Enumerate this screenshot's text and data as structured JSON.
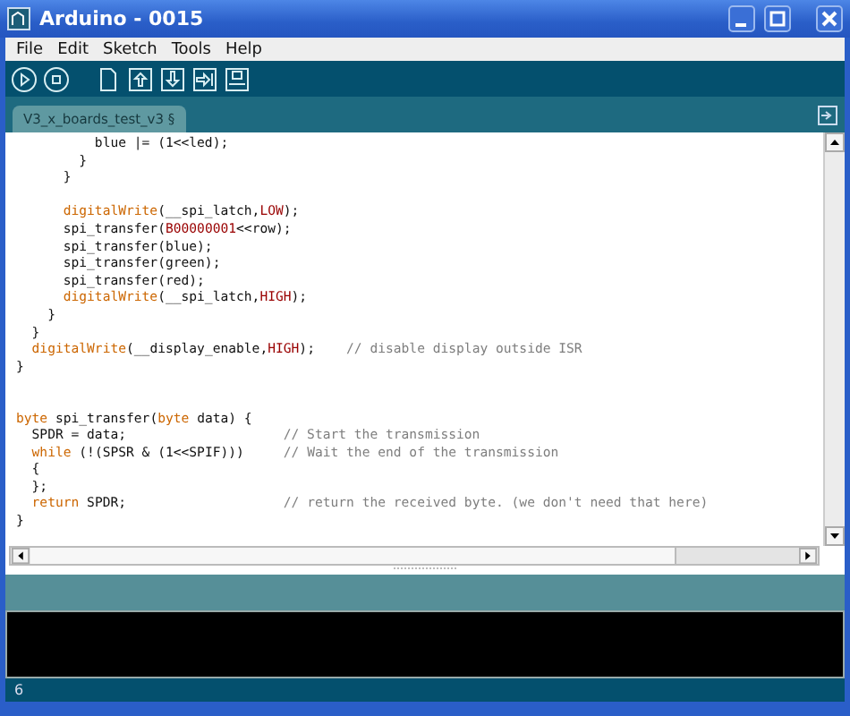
{
  "window": {
    "title": "Arduino - 0015"
  },
  "menu": [
    {
      "label": "File"
    },
    {
      "label": "Edit"
    },
    {
      "label": "Sketch"
    },
    {
      "label": "Tools"
    },
    {
      "label": "Help"
    }
  ],
  "tabs": [
    {
      "label": "V3_x_boards_test_v3 §",
      "selected": true
    }
  ],
  "editor": {
    "lines": [
      {
        "kind": "code",
        "tokens": [
          {
            "kind": "plain",
            "text": "          blue |= (1<<led);"
          }
        ]
      },
      {
        "kind": "code",
        "tokens": [
          {
            "kind": "plain",
            "text": "        }"
          }
        ]
      },
      {
        "kind": "code",
        "tokens": [
          {
            "kind": "plain",
            "text": "      }"
          }
        ]
      },
      {
        "kind": "blank"
      },
      {
        "kind": "code",
        "tokens": [
          {
            "kind": "keyword",
            "text": "      digitalWrite"
          },
          {
            "kind": "plain",
            "text": "(__spi_latch,"
          },
          {
            "kind": "constant",
            "text": "LOW"
          },
          {
            "kind": "plain",
            "text": ");"
          }
        ]
      },
      {
        "kind": "code",
        "tokens": [
          {
            "kind": "plain",
            "text": "      spi_transfer("
          },
          {
            "kind": "constant",
            "text": "B00000001"
          },
          {
            "kind": "plain",
            "text": "<<row);"
          }
        ]
      },
      {
        "kind": "code",
        "tokens": [
          {
            "kind": "plain",
            "text": "      spi_transfer(blue);"
          }
        ]
      },
      {
        "kind": "code",
        "tokens": [
          {
            "kind": "plain",
            "text": "      spi_transfer(green);"
          }
        ]
      },
      {
        "kind": "code",
        "tokens": [
          {
            "kind": "plain",
            "text": "      spi_transfer(red);"
          }
        ]
      },
      {
        "kind": "code",
        "tokens": [
          {
            "kind": "keyword",
            "text": "      digitalWrite"
          },
          {
            "kind": "plain",
            "text": "(__spi_latch,"
          },
          {
            "kind": "constant",
            "text": "HIGH"
          },
          {
            "kind": "plain",
            "text": ");"
          }
        ]
      },
      {
        "kind": "code",
        "tokens": [
          {
            "kind": "plain",
            "text": "    }"
          }
        ]
      },
      {
        "kind": "code",
        "tokens": [
          {
            "kind": "plain",
            "text": "  }"
          }
        ]
      },
      {
        "kind": "code",
        "tokens": [
          {
            "kind": "keyword",
            "text": "  digitalWrite"
          },
          {
            "kind": "plain",
            "text": "(__display_enable,"
          },
          {
            "kind": "constant",
            "text": "HIGH"
          },
          {
            "kind": "plain",
            "text": ");    "
          },
          {
            "kind": "comment",
            "text": "// disable display outside ISR"
          }
        ]
      },
      {
        "kind": "code",
        "tokens": [
          {
            "kind": "plain",
            "text": "}"
          }
        ]
      },
      {
        "kind": "blank"
      },
      {
        "kind": "blank"
      },
      {
        "kind": "code",
        "tokens": [
          {
            "kind": "keyword",
            "text": "byte"
          },
          {
            "kind": "plain",
            "text": " spi_transfer("
          },
          {
            "kind": "keyword",
            "text": "byte"
          },
          {
            "kind": "plain",
            "text": " data) {"
          }
        ]
      },
      {
        "kind": "code",
        "tokens": [
          {
            "kind": "plain",
            "text": "  SPDR = data;                    "
          },
          {
            "kind": "comment",
            "text": "// Start the transmission"
          }
        ]
      },
      {
        "kind": "code",
        "tokens": [
          {
            "kind": "keyword",
            "text": "  while"
          },
          {
            "kind": "plain",
            "text": " (!(SPSR & (1<<SPIF)))     "
          },
          {
            "kind": "comment",
            "text": "// Wait the end of the transmission"
          }
        ]
      },
      {
        "kind": "code",
        "tokens": [
          {
            "kind": "plain",
            "text": "  {"
          }
        ]
      },
      {
        "kind": "code",
        "tokens": [
          {
            "kind": "plain",
            "text": "  };"
          }
        ]
      },
      {
        "kind": "code",
        "tokens": [
          {
            "kind": "keyword",
            "text": "  return"
          },
          {
            "kind": "plain",
            "text": " SPDR;                    "
          },
          {
            "kind": "comment",
            "text": "// return the received byte. (we don't need that here)"
          }
        ]
      },
      {
        "kind": "code",
        "tokens": [
          {
            "kind": "plain",
            "text": "}"
          }
        ]
      }
    ]
  },
  "status_bar": {
    "line": "6"
  }
}
